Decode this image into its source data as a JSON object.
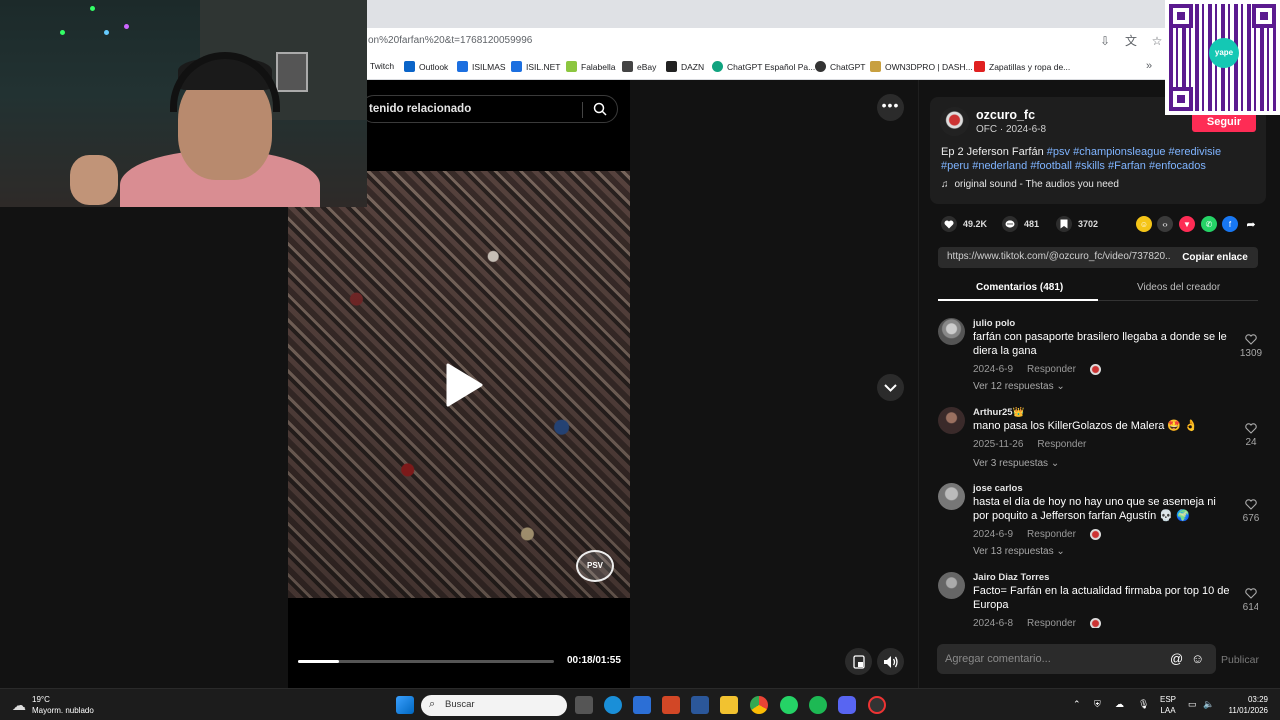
{
  "browser": {
    "url": "on%20farfan%20&t=1768120059996",
    "bookmarks": [
      "Twitch",
      "Outlook",
      "ISILMAS",
      "ISIL.NET",
      "Falabella",
      "eBay",
      "DAZN",
      "ChatGPT Español Pa...",
      "ChatGPT",
      "OWN3DPRO | DASH...",
      "Zapatillas y ropa de..."
    ]
  },
  "search": {
    "text": "tenido relacionado"
  },
  "video": {
    "time": "00:18/01:55",
    "progress": 0.16,
    "logo": "PSV"
  },
  "post": {
    "username": "ozcuro_fc",
    "subline": "OFC · 2024-6-8",
    "follow_label": "Seguir",
    "desc_prefix": "Ep 2 Jeferson Farfán",
    "tags": [
      "#psv",
      "#championsleague",
      "#eredivisie",
      "#peru",
      "#nederland",
      "#football",
      "#skills",
      "#Farfan",
      "#enfocados"
    ],
    "sound": "original sound - The audios you need",
    "likes": "49.2K",
    "comments": "481",
    "saves": "3702",
    "link": "https://www.tiktok.com/@ozcuro_fc/video/737820...",
    "copy_label": "Copiar enlace"
  },
  "tabs": {
    "comments": "Comentarios (481)",
    "creator": "Videos del creador"
  },
  "comments": [
    {
      "name": "julio polo",
      "text": "farfán con pasaporte brasilero llegaba a donde se le diera la gana",
      "date": "2024-6-9",
      "reply": "Responder",
      "replies": "Ver 12 respuestas",
      "likes": "1309"
    },
    {
      "name": "Arthur25👑",
      "text": "mano pasa los KillerGolazos de Malera 🤩 👌",
      "date": "2025-11-26",
      "reply": "Responder",
      "replies": "Ver 3 respuestas",
      "likes": "24"
    },
    {
      "name": "jose carlos",
      "text": "hasta el día de hoy no hay uno que se asemeja ni por poquito a Jefferson farfan Agustín 💀 🌍",
      "date": "2024-6-9",
      "reply": "Responder",
      "replies": "Ver 13 respuestas",
      "likes": "676"
    },
    {
      "name": "Jairo Diaz Torres",
      "text": "Facto= Farfán en la actualidad firmaba por top 10 de Europa",
      "date": "2024-6-8",
      "reply": "Responder",
      "replies": "",
      "likes": "614"
    }
  ],
  "composer": {
    "placeholder": "Agregar comentario...",
    "publish": "Publicar"
  },
  "taskbar": {
    "temp": "19°C",
    "weather": "Mayorm. nublado",
    "search": "Buscar",
    "lang1": "ESP",
    "lang2": "LAA",
    "time": "03:29",
    "date": "11/01/2026"
  },
  "qr": {
    "brand": "yape"
  }
}
